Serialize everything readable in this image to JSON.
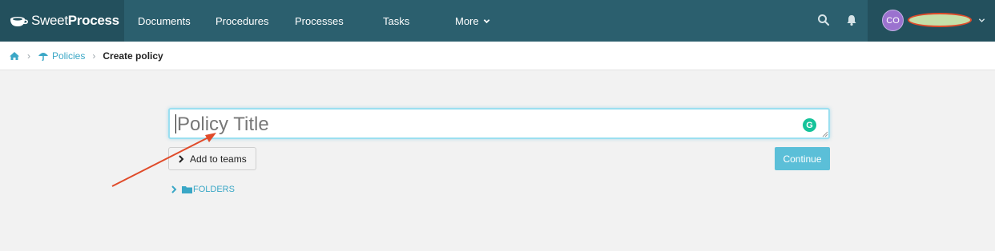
{
  "app": {
    "logo_sweet": "Sweet",
    "logo_process": "Process"
  },
  "nav": {
    "items": [
      {
        "label": "Documents"
      },
      {
        "label": "Procedures"
      },
      {
        "label": "Processes"
      },
      {
        "label": "Tasks"
      },
      {
        "label": "More"
      }
    ]
  },
  "user": {
    "initials": "CO"
  },
  "breadcrumb": {
    "policies": "Policies",
    "current": "Create policy"
  },
  "form": {
    "title_placeholder": "Policy Title",
    "title_value": "",
    "add_to_teams": "Add to teams",
    "continue_label": "Continue",
    "folders_label": "FOLDERS"
  },
  "colors": {
    "nav_bg": "#2b5f6e",
    "nav_dark": "#23505d",
    "accent": "#3aa7c6",
    "continue_bg": "#5bbfd8",
    "annotation": "#e04b2a"
  }
}
